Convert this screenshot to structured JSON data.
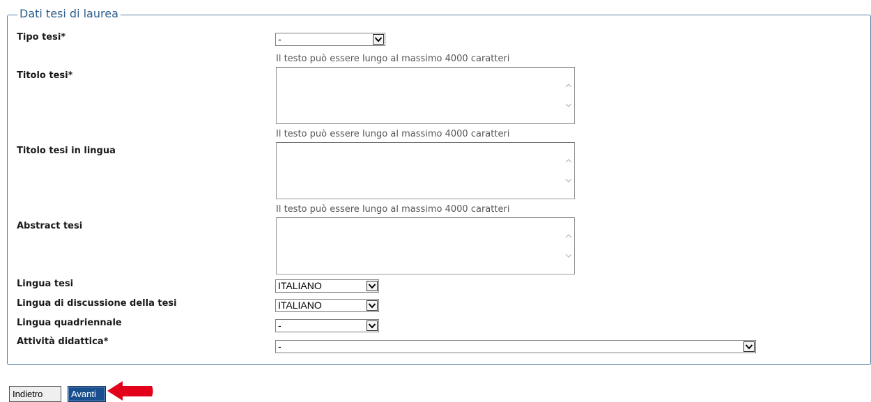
{
  "form": {
    "legend": "Dati tesi di laurea",
    "length_hint": "Il testo può essere lungo al massimo 4000 caratteri",
    "fields": {
      "tipo_tesi": {
        "label": "Tipo tesi*",
        "value": "-"
      },
      "titolo_tesi": {
        "label": "Titolo tesi*",
        "value": ""
      },
      "titolo_lingua": {
        "label": "Titolo tesi in lingua",
        "value": ""
      },
      "abstract": {
        "label": "Abstract tesi",
        "value": ""
      },
      "lingua_tesi": {
        "label": "Lingua tesi",
        "value": "ITALIANO"
      },
      "lingua_discussione": {
        "label": "Lingua di discussione della tesi",
        "value": "ITALIANO"
      },
      "lingua_quadriennale": {
        "label": "Lingua quadriennale",
        "value": "-"
      },
      "attivita_didattica": {
        "label": "Attività didattica*",
        "value": "-"
      }
    }
  },
  "actions": {
    "back_label": "Indietro",
    "next_label": "Avanti"
  },
  "colors": {
    "legend": "#2d5e8c",
    "fieldset_border": "#5b7fa0",
    "next_button": "#1a4f8f",
    "pointer_arrow": "#e3001b"
  },
  "icons": {
    "dropdown": "chevron-down-icon",
    "scroll_up": "chevron-up-icon",
    "scroll_down": "chevron-down-icon",
    "pointer": "arrow-left-icon"
  }
}
